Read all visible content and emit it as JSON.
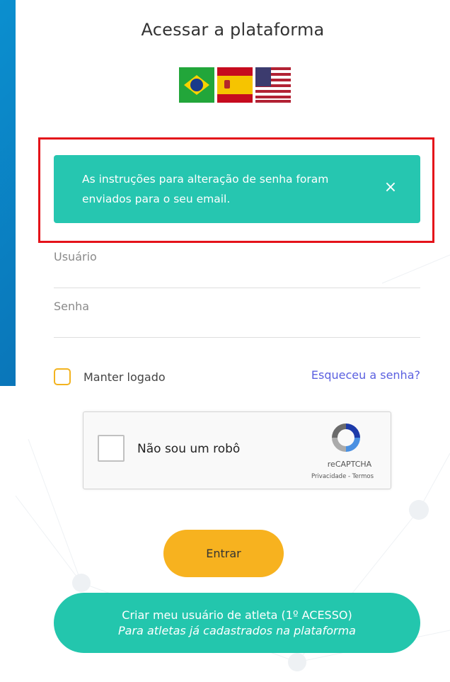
{
  "page": {
    "title": "Acessar a plataforma"
  },
  "languages": [
    {
      "name": "brazil-flag-icon"
    },
    {
      "name": "spain-flag-icon"
    },
    {
      "name": "usa-flag-icon"
    }
  ],
  "alert": {
    "message": "As instruções para alteração de senha foram enviados para o seu email.",
    "close_icon": "×",
    "color": "#26c6b0"
  },
  "form": {
    "username_placeholder": "Usuário",
    "password_placeholder": "Senha",
    "remember_label": "Manter logado",
    "forgot_link": "Esqueceu a senha?"
  },
  "recaptcha": {
    "label": "Não sou um robô",
    "brand": "reCAPTCHA",
    "terms": "Privacidade - Termos"
  },
  "buttons": {
    "enter": "Entrar",
    "athlete_line1": "Criar meu usuário de atleta (1º ACESSO)",
    "athlete_line2": "Para atletas já cadastrados na plataforma"
  },
  "colors": {
    "accent_yellow": "#f7b21f",
    "accent_teal": "#23c6ad",
    "link": "#5b60e0",
    "highlight_red": "#e4131a"
  }
}
